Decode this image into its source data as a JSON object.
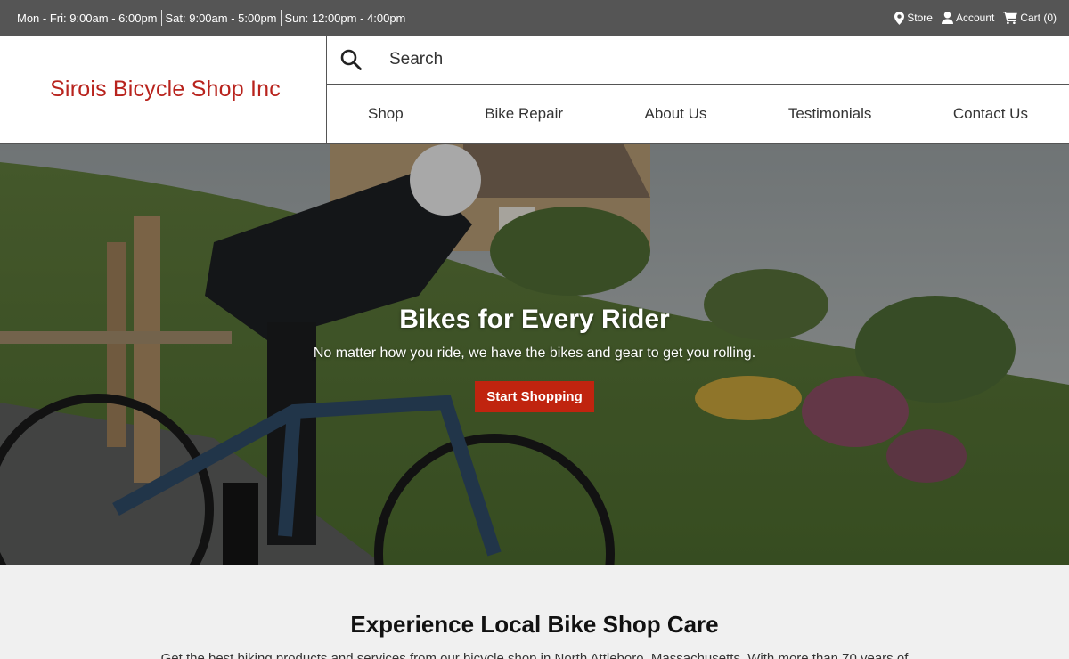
{
  "topbar": {
    "hours": [
      "Mon - Fri: 9:00am - 6:00pm",
      "Sat: 9:00am - 5:00pm",
      "Sun: 12:00pm - 4:00pm"
    ],
    "store_label": "Store",
    "account_label": "Account",
    "cart_label": "Cart (0)"
  },
  "header": {
    "logo_text": "Sirois Bicycle Shop Inc",
    "search_placeholder": "Search"
  },
  "nav": {
    "items": [
      "Shop",
      "Bike Repair",
      "About Us",
      "Testimonials",
      "Contact Us"
    ]
  },
  "hero": {
    "title": "Bikes for Every Rider",
    "subtitle": "No matter how you ride, we have the bikes and gear to get you rolling.",
    "cta_label": "Start Shopping"
  },
  "section": {
    "title": "Experience Local Bike Shop Care",
    "text": "Get the best biking products and services from our bicycle shop in North Attleboro, Massachusetts. With more than 70 years of"
  },
  "colors": {
    "topbar_bg": "#555555",
    "brand_red": "#b8231d",
    "cta_red": "#c0240f",
    "section_bg": "#f0f0f0"
  },
  "icons": {
    "store": "map-pin-icon",
    "account": "user-icon",
    "cart": "cart-icon",
    "search": "search-icon"
  }
}
